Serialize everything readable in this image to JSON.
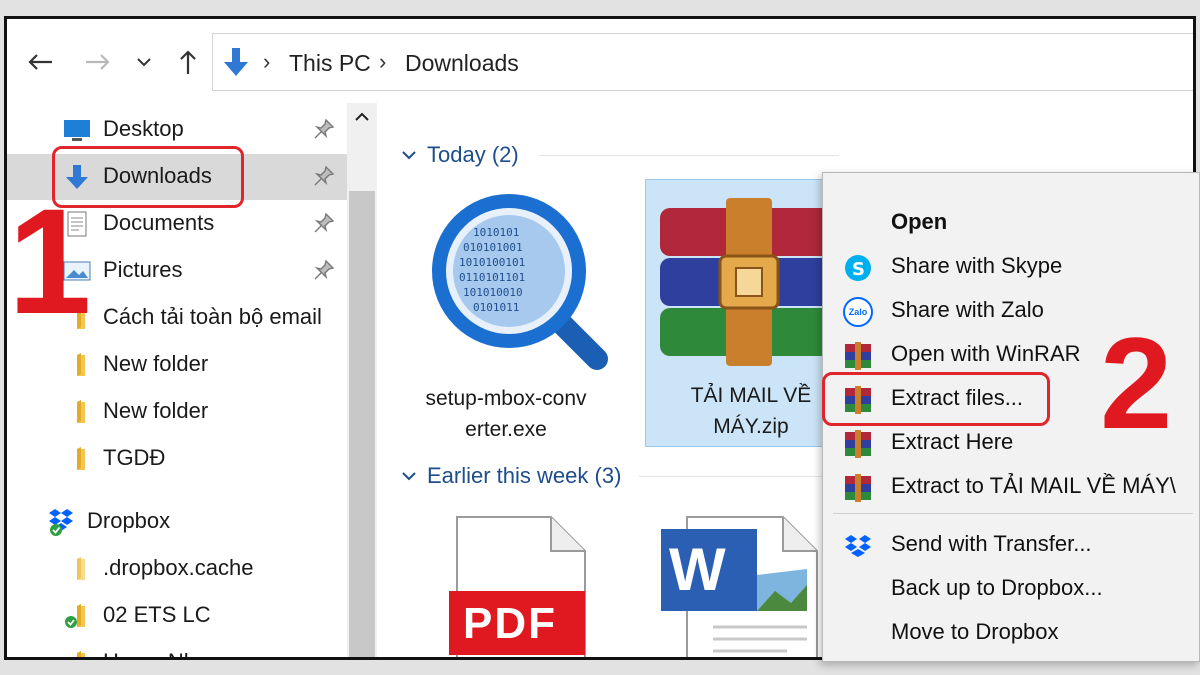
{
  "address_bar": {
    "crumbs": [
      "This PC",
      "Downloads"
    ]
  },
  "nav_pane": {
    "items": [
      {
        "label": "Desktop"
      },
      {
        "label": "Downloads"
      },
      {
        "label": "Documents"
      },
      {
        "label": "Pictures"
      },
      {
        "label": "Cách tải toàn bộ email"
      },
      {
        "label": "New folder"
      },
      {
        "label": "New folder"
      },
      {
        "label": "TGDĐ"
      },
      {
        "label": "Dropbox"
      },
      {
        "label": ".dropbox.cache"
      },
      {
        "label": "02 ETS LC"
      },
      {
        "label": "Hong_Nhung"
      }
    ]
  },
  "content": {
    "groups": [
      {
        "label": "Today (2)"
      },
      {
        "label": "Earlier this week (3)"
      }
    ],
    "files": [
      {
        "name_line1": "setup-mbox-conv",
        "name_line2": "erter.exe"
      },
      {
        "name_line1": "TẢI MAIL VỀ",
        "name_line2": "MÁY.zip"
      },
      {
        "badge": "PDF"
      },
      {
        "badge": "W"
      }
    ]
  },
  "context_menu": {
    "items": [
      {
        "label": "Open"
      },
      {
        "label": "Share with Skype"
      },
      {
        "label": "Share with Zalo"
      },
      {
        "label": "Open with WinRAR"
      },
      {
        "label": "Extract files..."
      },
      {
        "label": "Extract Here"
      },
      {
        "label": "Extract to TẢI MAIL VỀ MÁY\\"
      },
      {
        "label": "Send with Transfer..."
      },
      {
        "label": "Back up to Dropbox..."
      },
      {
        "label": "Move to Dropbox"
      }
    ],
    "zalo_text": "Zalo"
  },
  "annotations": {
    "step1": "1",
    "step2": "2",
    "color": "#e0181f"
  }
}
